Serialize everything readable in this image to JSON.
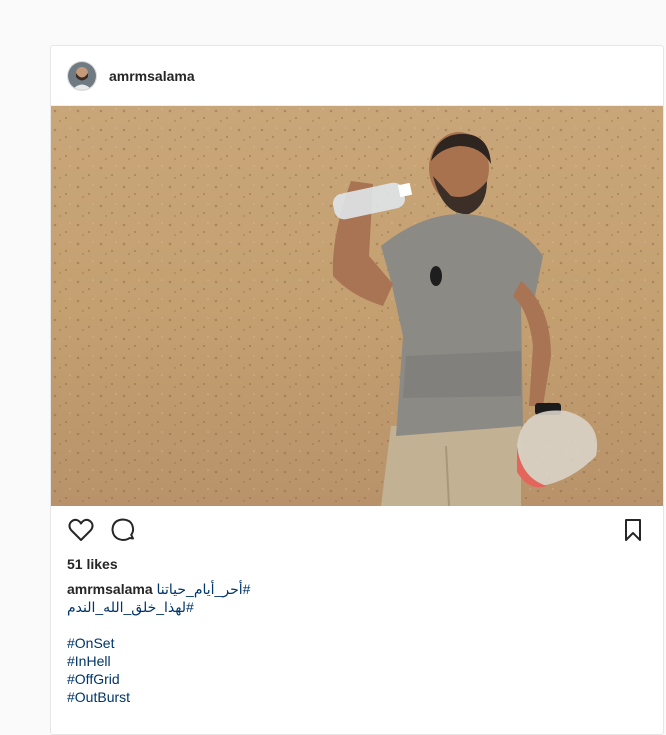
{
  "post": {
    "username": "amrmsalama",
    "likes": "51 likes",
    "caption_first_tag": "#أحر_أيام_حياتنا",
    "caption_second_tag": "#لهذا_خلق_الله_الندم",
    "hashtags": [
      "#OnSet",
      "#InHell",
      "#OffGrid",
      "#OutBurst"
    ]
  },
  "icons": {
    "like": "heart-outline-icon",
    "comment": "comment-bubble-icon",
    "save": "bookmark-icon"
  },
  "colors": {
    "hashtag": "#003569",
    "text": "#262626",
    "border": "#e6e6e6"
  }
}
